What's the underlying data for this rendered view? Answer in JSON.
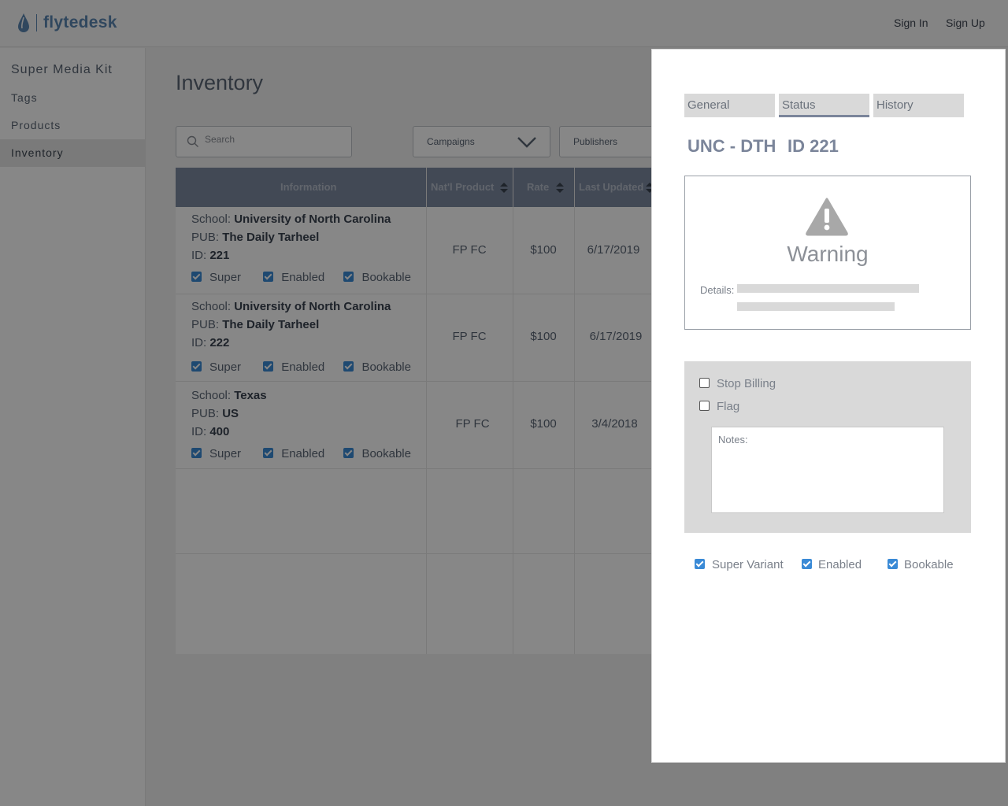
{
  "header": {
    "logo_text": "flytedesk",
    "sign_in": "Sign In",
    "sign_up": "Sign Up"
  },
  "sidebar": {
    "items": [
      {
        "label": "Super Media Kit"
      },
      {
        "label": "Tags"
      },
      {
        "label": "Products"
      },
      {
        "label": "Inventory",
        "active": true
      }
    ]
  },
  "main": {
    "title": "Inventory",
    "search_placeholder": "Search",
    "filters": {
      "campaigns": "Campaigns",
      "publishers": "Publishers"
    },
    "table": {
      "columns": [
        "Information",
        "Nat'l Product",
        "Rate",
        "Last Updated"
      ],
      "rows": [
        {
          "school_label": "School: ",
          "school": "University of North Carolina",
          "pub_label": "PUB: ",
          "pub": "The Daily Tarheel",
          "id_label": "ID: ",
          "id": "221",
          "product": "FP FC",
          "rate": "$100",
          "updated": "6/17/2019"
        },
        {
          "school_label": "School: ",
          "school": "University of North Carolina",
          "pub_label": "PUB: ",
          "pub": "The Daily Tarheel",
          "id_label": "ID: ",
          "id": "222",
          "product": "FP FC",
          "rate": "$100",
          "updated": "6/17/2019"
        },
        {
          "school_label": "School: ",
          "school": "Texas",
          "pub_label": "PUB: ",
          "pub": "US",
          "id_label": "ID: ",
          "id": "400",
          "product": "FP FC",
          "rate": "$100",
          "updated": "3/4/2018"
        }
      ],
      "flags": {
        "super": "Super",
        "enabled": "Enabled",
        "bookable": "Bookable"
      }
    }
  },
  "modal": {
    "tabs": [
      {
        "label": "General"
      },
      {
        "label": "Status",
        "active": true
      },
      {
        "label": "History"
      }
    ],
    "code": "UNC - DTH",
    "id": "ID 221",
    "warning": {
      "title": "Warning",
      "details_label": "Details:"
    },
    "status": {
      "stop_billing": "Stop Billing",
      "stop_billing_checked": false,
      "flag": "Flag",
      "flag_checked": false,
      "notes_placeholder": "Notes:"
    },
    "options": {
      "super_variant": "Super Variant",
      "enabled": "Enabled",
      "bookable": "Bookable"
    }
  },
  "colors": {
    "accent": "#3a8ad6",
    "brand": "#5b86b2",
    "tab_underline": "#7b859a"
  }
}
